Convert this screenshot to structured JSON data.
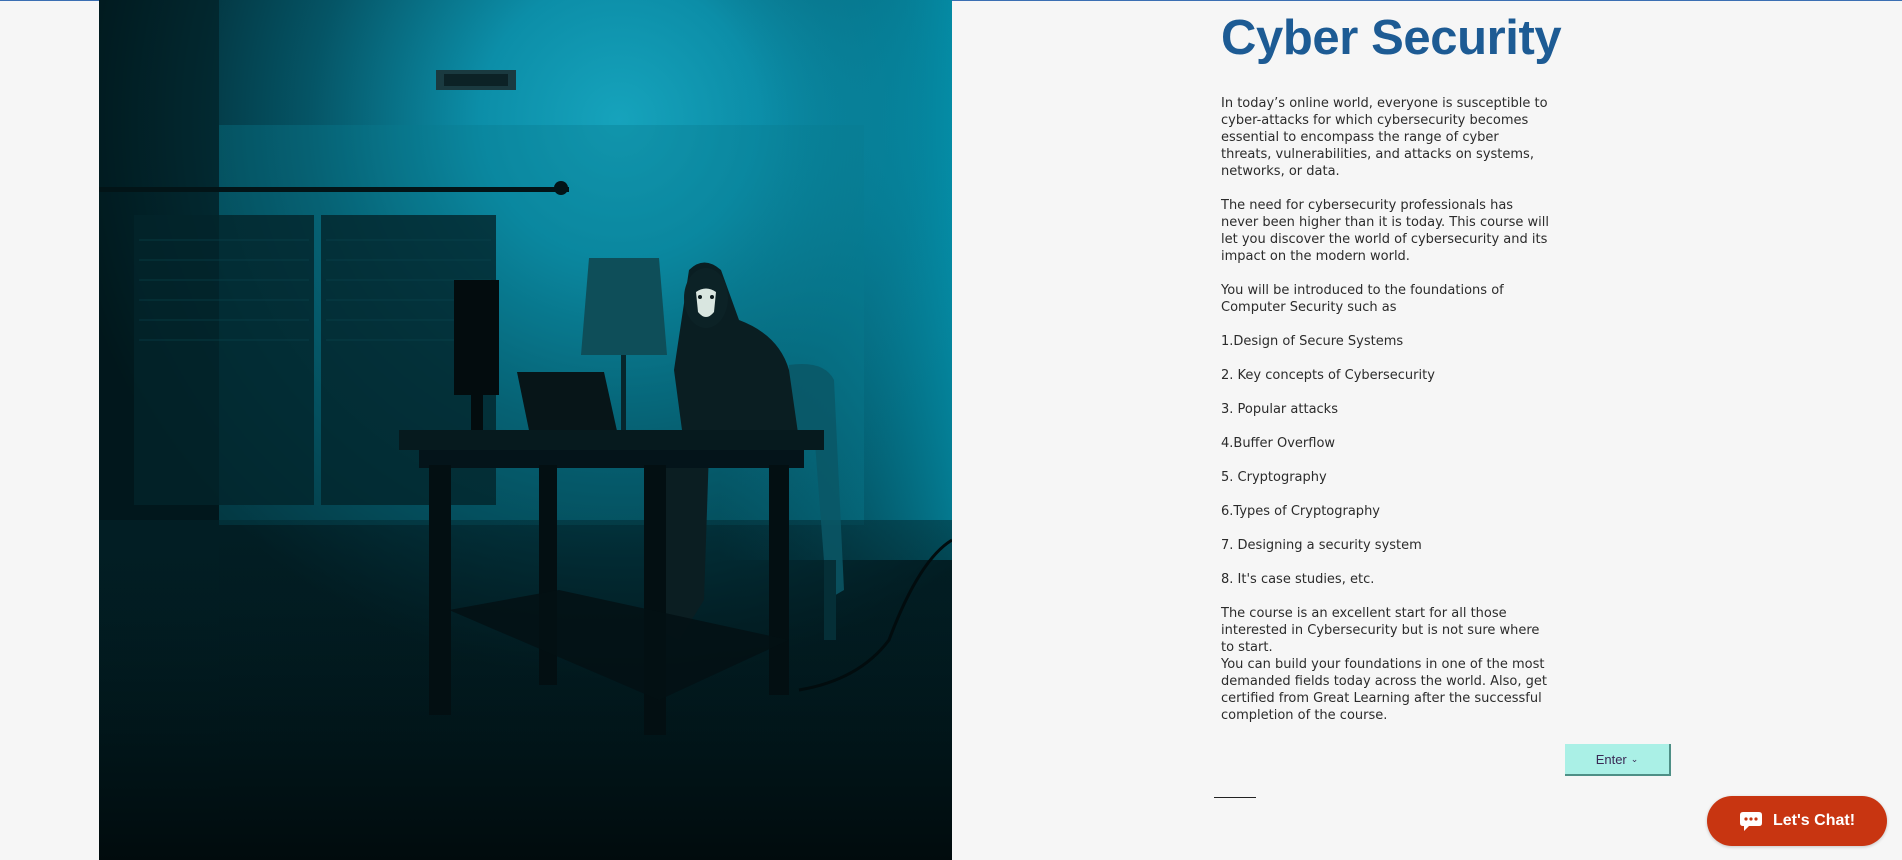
{
  "page": {
    "title": "Cyber Security",
    "paragraphs": [
      "In today’s online world, everyone is susceptible to cyber-attacks for which cybersecurity becomes essential to encompass the range of cyber threats, vulnerabilities, and attacks on systems, networks, or data.",
      "The need for cybersecurity professionals has never been higher than it is today. This course will let you discover the world of cybersecurity and its impact on the modern world.",
      "You will be introduced to the foundations of Computer Security such as"
    ],
    "topics": [
      "1.Design of Secure Systems",
      "2. Key concepts of Cybersecurity",
      "3. Popular attacks",
      "4.Buffer Overflow",
      "5. Cryptography",
      "6.Types of Cryptography",
      "7. Designing a security system",
      "8. It's case studies, etc."
    ],
    "closing": [
      "The course is an excellent start for all those interested in Cybersecurity but is not sure where to start.",
      "You can build your foundations in one of the most demanded fields today across the world. Also, get certified from Great Learning after the successful completion of the course."
    ],
    "enter_label": "Enter",
    "enter_icon": "chevron-down-icon"
  },
  "chat": {
    "label": "Let's Chat!",
    "icon": "chat-bubble-icon"
  },
  "colors": {
    "title": "#1d5b94",
    "enter_button": "#aaf0e6",
    "chat_button": "#c83511",
    "page_background": "#f6f6f6"
  }
}
